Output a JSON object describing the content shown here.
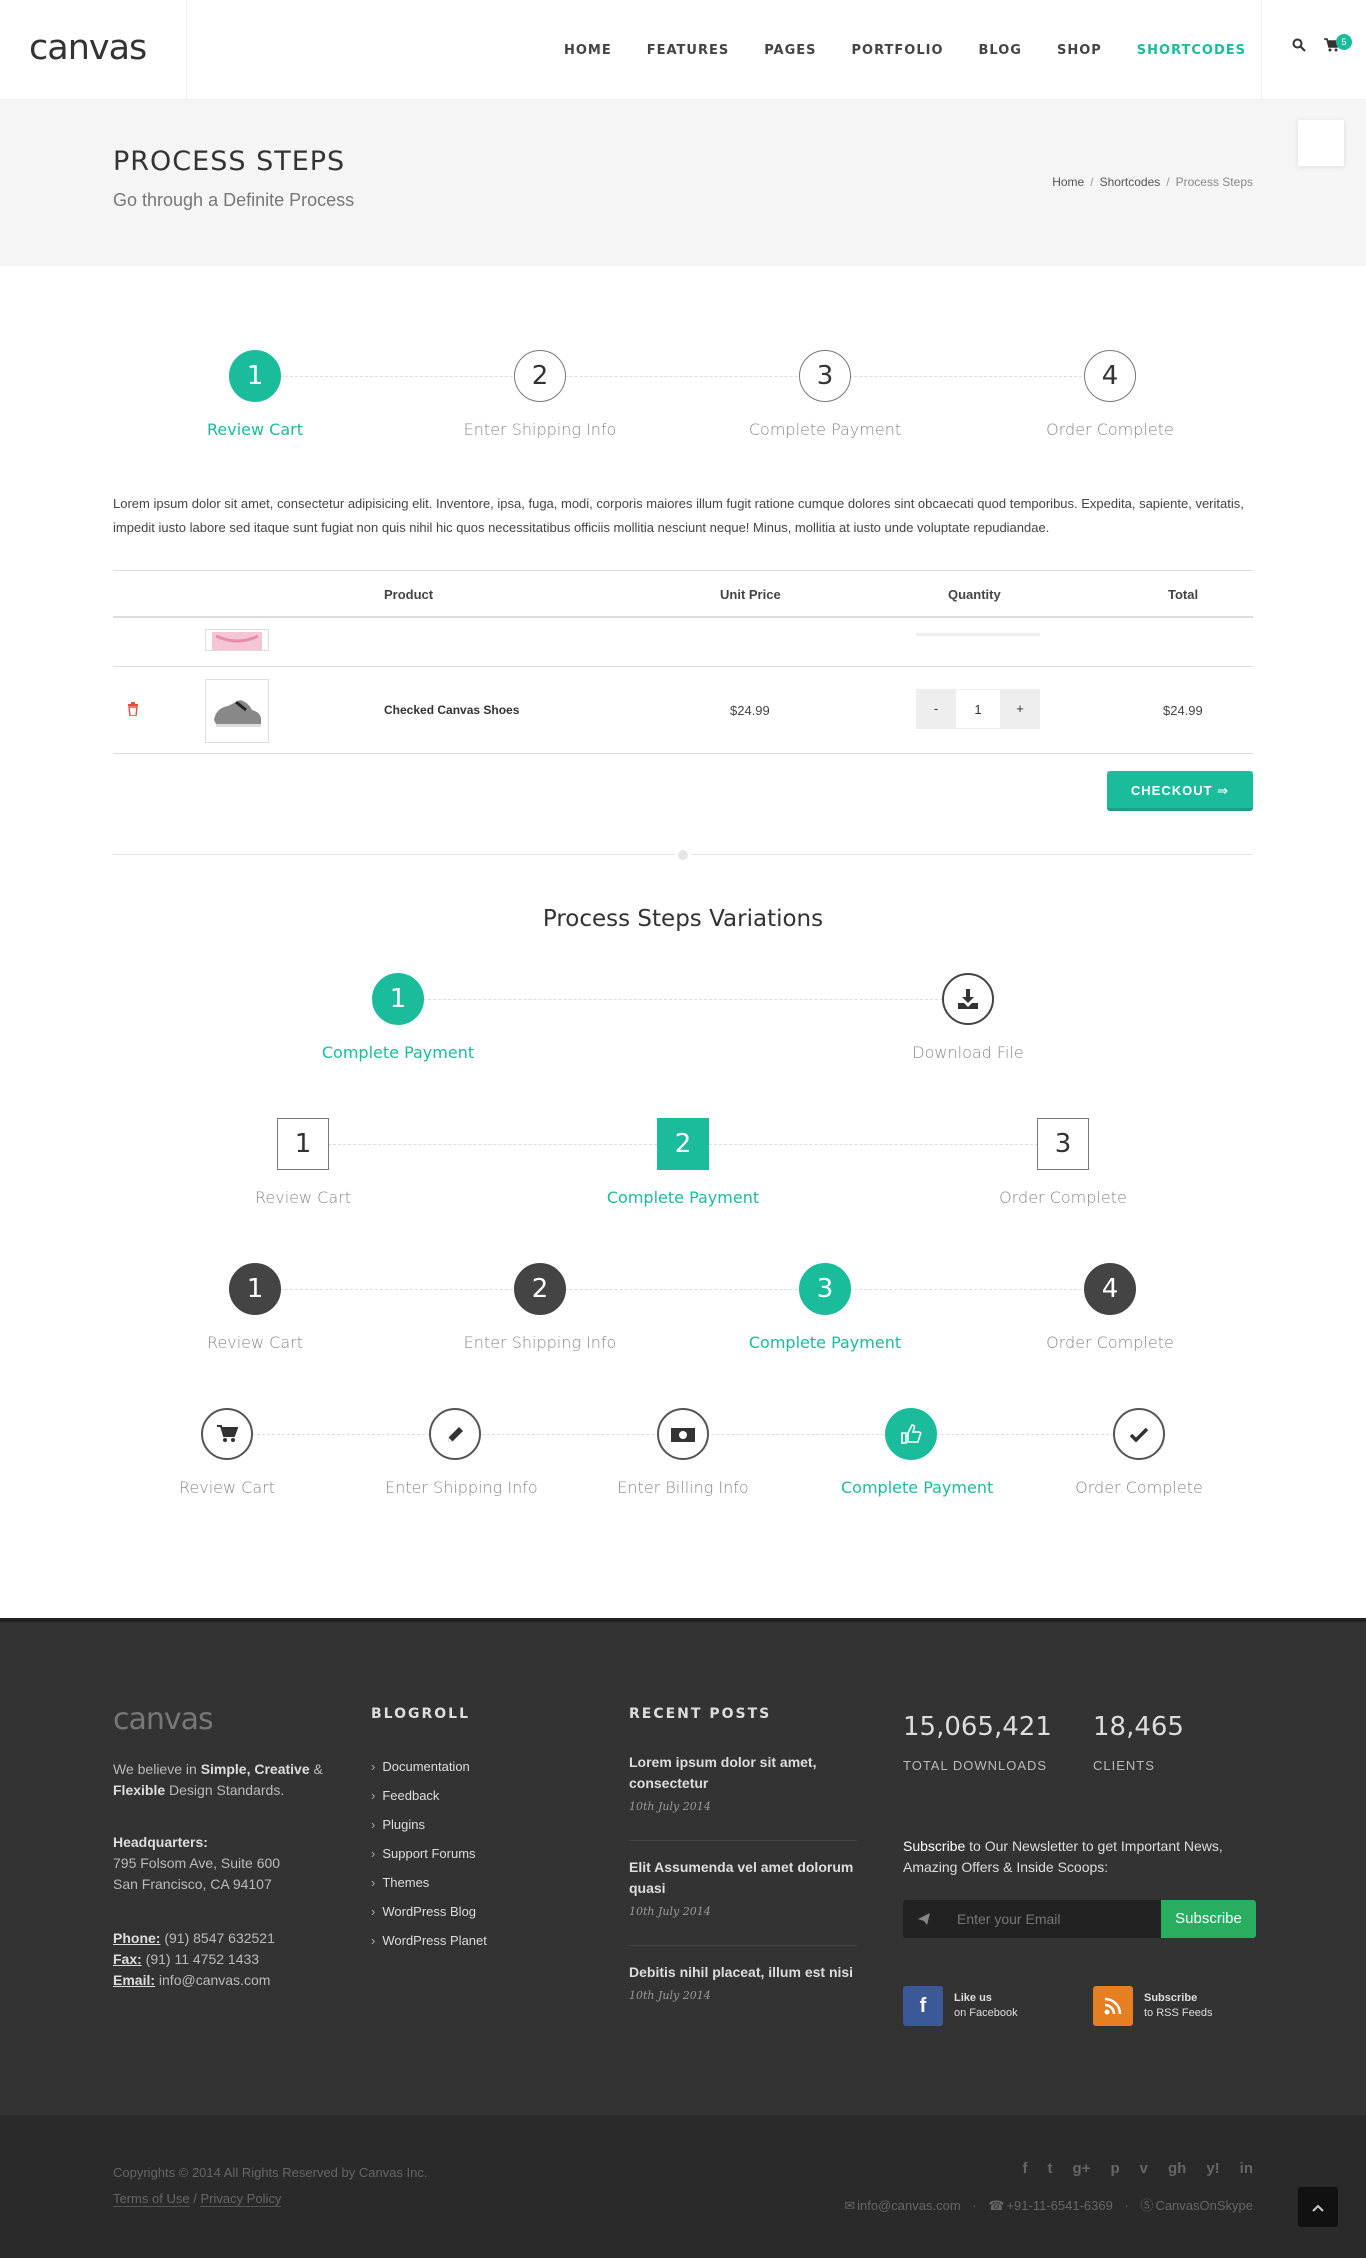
{
  "header": {
    "logo": "canvas",
    "nav": [
      "HOME",
      "FEATURES",
      "PAGES",
      "PORTFOLIO",
      "BLOG",
      "SHOP",
      "SHORTCODES"
    ],
    "cart_count": "5"
  },
  "page_title": {
    "title": "PROCESS STEPS",
    "subtitle": "Go through a Definite Process",
    "breadcrumb": [
      "Home",
      "Shortcodes",
      "Process Steps"
    ]
  },
  "steps_main": [
    {
      "num": "1",
      "label": "Review Cart"
    },
    {
      "num": "2",
      "label": "Enter Shipping Info"
    },
    {
      "num": "3",
      "label": "Complete Payment"
    },
    {
      "num": "4",
      "label": "Order Complete"
    }
  ],
  "lorem": "Lorem ipsum dolor sit amet, consectetur adipisicing elit. Inventore, ipsa, fuga, modi, corporis maiores illum fugit ratione cumque dolores sint obcaecati quod temporibus. Expedita, sapiente, veritatis, impedit iusto labore sed itaque sunt fugiat non quis nihil hic quos necessitatibus officiis mollitia nesciunt neque! Minus, mollitia at iusto unde voluptate repudiandae.",
  "cart": {
    "headers": [
      "Product",
      "Unit Price",
      "Quantity",
      "Total"
    ],
    "item": {
      "name": "Checked Canvas Shoes",
      "price": "$24.99",
      "qty": "1",
      "total": "$24.99",
      "minus": "-",
      "plus": "+"
    },
    "checkout": "CHECKOUT ⇒"
  },
  "variations": {
    "title": "Process Steps Variations",
    "v1": [
      {
        "num": "1",
        "label": "Complete Payment"
      },
      {
        "label": "Download File"
      }
    ],
    "v2": [
      {
        "num": "1",
        "label": "Review Cart"
      },
      {
        "num": "2",
        "label": "Complete Payment"
      },
      {
        "num": "3",
        "label": "Order Complete"
      }
    ],
    "v3": [
      {
        "num": "1",
        "label": "Review Cart"
      },
      {
        "num": "2",
        "label": "Enter Shipping Info"
      },
      {
        "num": "3",
        "label": "Complete Payment"
      },
      {
        "num": "4",
        "label": "Order Complete"
      }
    ],
    "v4": [
      {
        "label": "Review Cart"
      },
      {
        "label": "Enter Shipping Info"
      },
      {
        "label": "Enter Billing Info"
      },
      {
        "label": "Complete Payment"
      },
      {
        "label": "Order Complete"
      }
    ]
  },
  "footer": {
    "logo": "canvas",
    "about_pre": "We believe in ",
    "about_b1": "Simple, Creative",
    "about_mid": " & ",
    "about_b2": "Flexible",
    "about_post": " Design Standards.",
    "hq_label": "Headquarters:",
    "hq_line1": "795 Folsom Ave, Suite 600",
    "hq_line2": "San Francisco, CA 94107",
    "phone_label": "Phone:",
    "phone": " (91) 8547 632521",
    "fax_label": "Fax:",
    "fax": " (91) 11 4752 1433",
    "email_label": "Email:",
    "email": " info@canvas.com",
    "blogroll_title": "BLOGROLL",
    "blogroll": [
      "Documentation",
      "Feedback",
      "Plugins",
      "Support Forums",
      "Themes",
      "WordPress Blog",
      "WordPress Planet"
    ],
    "recent_title": "RECENT POSTS",
    "posts": [
      {
        "title": "Lorem ipsum dolor sit amet, consectetur",
        "date": "10th July 2014"
      },
      {
        "title": "Elit Assumenda vel amet dolorum quasi",
        "date": "10th July 2014"
      },
      {
        "title": "Debitis nihil placeat, illum est nisi",
        "date": "10th July 2014"
      }
    ],
    "counter1": "15,065,421",
    "counter1_label": "TOTAL DOWNLOADS",
    "counter2": "18,465",
    "counter2_label": "CLIENTS",
    "nl_pre": "Subscribe",
    "nl_text": " to Our Newsletter to get Important News, Amazing Offers & Inside Scoops:",
    "nl_placeholder": "Enter your Email",
    "nl_button": "Subscribe",
    "fb_line1": "Like us",
    "fb_line2": "on Facebook",
    "rss_line1": "Subscribe",
    "rss_line2": "to RSS Feeds"
  },
  "copyrights": {
    "text": "Copyrights © 2014 All Rights Reserved by Canvas Inc.",
    "terms": "Terms of Use",
    "sep": "/",
    "privacy": "Privacy Policy",
    "social": [
      "f",
      "t",
      "g+",
      "p",
      "v",
      "gh",
      "y!",
      "in"
    ],
    "email": "info@canvas.com",
    "dot1": "·",
    "phone": "+91-11-6541-6369",
    "dot2": "·",
    "skype": "CanvasOnSkype"
  },
  "colors": {
    "accent": "#1abc9c",
    "dark": "#444444",
    "footer": "#333333",
    "subscribe": "#27ae60",
    "facebook": "#3b5998",
    "rss": "#e67e22"
  }
}
